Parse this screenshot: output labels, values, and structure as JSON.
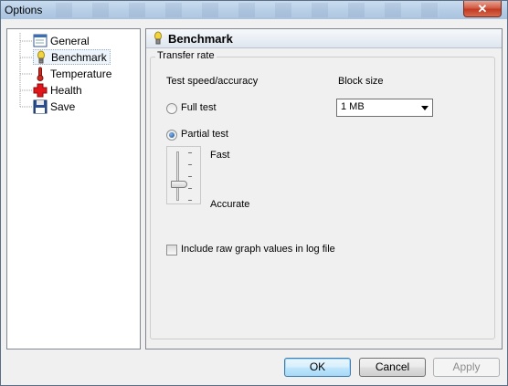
{
  "window": {
    "title": "Options",
    "close_label": "✕"
  },
  "tree": {
    "items": [
      {
        "label": "General",
        "icon": "general-icon"
      },
      {
        "label": "Benchmark",
        "icon": "benchmark-icon",
        "selected": true
      },
      {
        "label": "Temperature",
        "icon": "thermometer-icon"
      },
      {
        "label": "Health",
        "icon": "health-cross-icon"
      },
      {
        "label": "Save",
        "icon": "floppy-disk-icon"
      }
    ]
  },
  "panel": {
    "title": "Benchmark",
    "group_title": "Transfer rate",
    "test_speed_label": "Test speed/accuracy",
    "full_test_label": "Full test",
    "partial_test_label": "Partial test",
    "selected_test": "Partial test",
    "fast_label": "Fast",
    "accurate_label": "Accurate",
    "slider_level": 0.67,
    "block_size_label": "Block size",
    "block_size_value": "1 MB",
    "include_raw_label": "Include raw graph values in log file",
    "include_raw_checked": false
  },
  "buttons": {
    "ok": "OK",
    "cancel": "Cancel",
    "apply": "Apply"
  },
  "colors": {
    "selection_bg": "#eef4fb",
    "health_red": "#e0161b",
    "default_button_border": "#3c7fb1"
  }
}
